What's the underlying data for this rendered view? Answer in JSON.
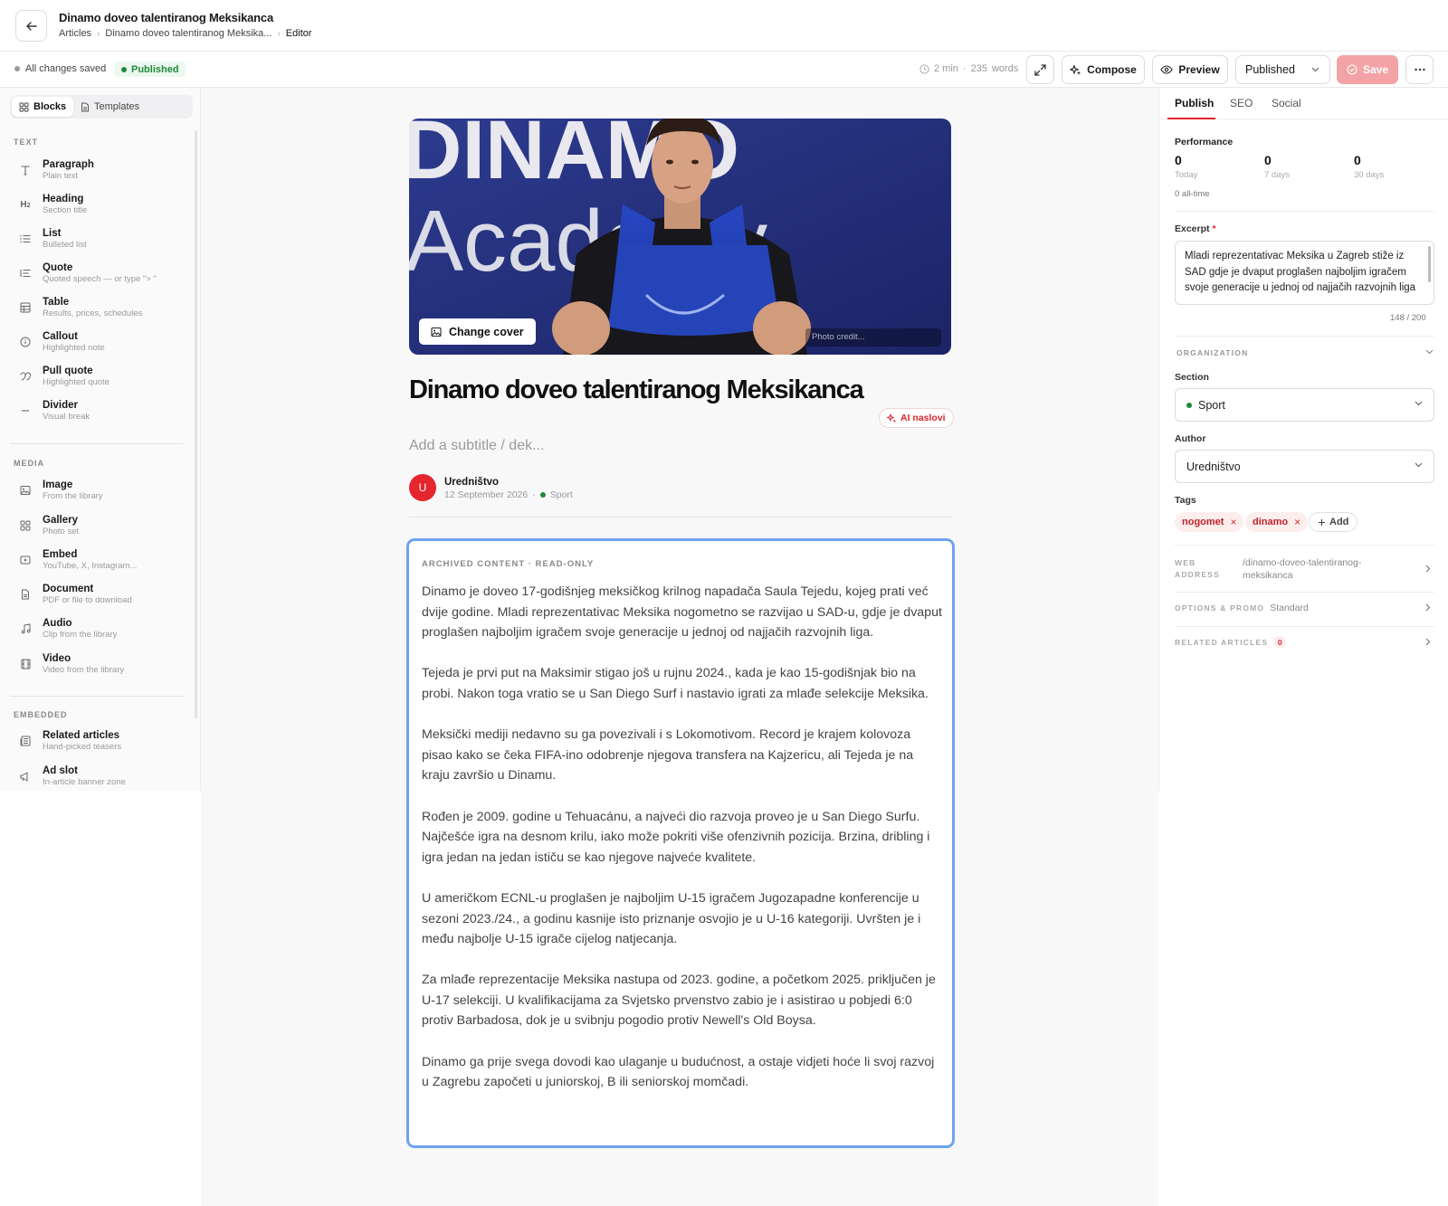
{
  "header": {
    "title": "Dinamo doveo talentiranog Meksikanca",
    "breadcrumbs": [
      "Articles",
      "Dinamo doveo talentiranog Meksika...",
      "Editor"
    ]
  },
  "toolbar": {
    "save_status": "All changes saved",
    "status_badge": "Published",
    "read_time": "2 min",
    "separator": "·",
    "word_count": "235",
    "words_label": "words",
    "compose_label": "Compose",
    "preview_label": "Preview",
    "status_select": "Published",
    "save_label": "Save"
  },
  "left_sidebar": {
    "tabs": [
      "Blocks",
      "Templates"
    ],
    "sections": [
      {
        "title": "TEXT",
        "items": [
          {
            "name": "Paragraph",
            "desc": "Plain text",
            "icon": "type-icon"
          },
          {
            "name": "Heading",
            "desc": "Section title",
            "icon": "heading-icon"
          },
          {
            "name": "List",
            "desc": "Bulleted list",
            "icon": "list-icon"
          },
          {
            "name": "Quote",
            "desc": "Quoted speech — or type \"> \"",
            "icon": "quote-icon"
          },
          {
            "name": "Table",
            "desc": "Results, prices, schedules",
            "icon": "table-icon"
          },
          {
            "name": "Callout",
            "desc": "Highlighted note",
            "icon": "info-icon"
          },
          {
            "name": "Pull quote",
            "desc": "Highlighted quote",
            "icon": "pull-quote-icon"
          },
          {
            "name": "Divider",
            "desc": "Visual break",
            "icon": "minus-icon"
          }
        ]
      },
      {
        "title": "MEDIA",
        "items": [
          {
            "name": "Image",
            "desc": "From the library",
            "icon": "image-icon"
          },
          {
            "name": "Gallery",
            "desc": "Photo set",
            "icon": "gallery-icon"
          },
          {
            "name": "Embed",
            "desc": "YouTube, X, Instagram...",
            "icon": "embed-icon"
          },
          {
            "name": "Document",
            "desc": "PDF or file to download",
            "icon": "document-icon"
          },
          {
            "name": "Audio",
            "desc": "Clip from the library",
            "icon": "music-icon"
          },
          {
            "name": "Video",
            "desc": "Video from the library",
            "icon": "film-icon"
          }
        ]
      },
      {
        "title": "EMBEDDED",
        "items": [
          {
            "name": "Related articles",
            "desc": "Hand-picked teasers",
            "icon": "newspaper-icon"
          },
          {
            "name": "Ad slot",
            "desc": "In-article banner zone",
            "icon": "megaphone-icon"
          }
        ]
      }
    ]
  },
  "editor": {
    "cover_button": "Change cover",
    "photo_credit_placeholder": "Photo credit...",
    "cover_text": [
      "DINAMO",
      "Academy"
    ],
    "title": "Dinamo doveo talentiranog Meksikanca",
    "ai_button": "AI naslovi",
    "subtitle_placeholder": "Add a subtitle / dek...",
    "author_initial": "U",
    "author": "Uredništvo",
    "date": "12 September 2026",
    "meta_sep": "·",
    "section": "Sport",
    "archive_label": "ARCHIVED CONTENT · READ-ONLY",
    "paragraphs": [
      "Dinamo je doveo 17-godišnjeg meksičkog krilnog napadača Saula Tejedu, kojeg prati već dvije godine. Mladi reprezentativac Meksika nogometno se razvijao u SAD-u, gdje je dvaput proglašen najboljim igračem svoje generacije u jednoj od najjačih razvojnih liga.",
      "Tejeda je prvi put na Maksimir stigao još u rujnu 2024., kada je kao 15-godišnjak bio na probi. Nakon toga vratio se u San Diego Surf i nastavio igrati za mlađe selekcije Meksika.",
      "Meksički mediji nedavno su ga povezivali i s Lokomotivom. Record je krajem kolovoza pisao kako se čeka FIFA-ino odobrenje njegova transfera na Kajzericu, ali Tejeda je na kraju završio u Dinamu.",
      "Rođen je 2009. godine u Tehuacánu, a najveći dio razvoja proveo je u San Diego Surfu. Najčešće igra na desnom krilu, iako može pokriti više ofenzivnih pozicija. Brzina, dribling i igra jedan na jedan ističu se kao njegove najveće kvalitete.",
      "U američkom ECNL-u proglašen je najboljim U-15 igračem Jugozapadne konferencije u sezoni 2023./24., a godinu kasnije isto priznanje osvojio je u U-16 kategoriji. Uvršten je i među najbolje U-15 igrače cijelog natjecanja.",
      "Za mlađe reprezentacije Meksika nastupa od 2023. godine, a početkom 2025. priključen je U-17 selekciji. U kvalifikacijama za Svjetsko prvenstvo zabio je i asistirao u pobjedi 6:0 protiv Barbadosa, dok je u svibnju pogodio protiv Newell's Old Boysa.",
      "Dinamo ga prije svega dovodi kao ulaganje u budućnost, a ostaje vidjeti hoće li svoj razvoj u Zagrebu započeti u juniorskoj, B ili seniorskoj momčadi."
    ]
  },
  "right_sidebar": {
    "tabs": [
      "Publish",
      "SEO",
      "Social"
    ],
    "performance": {
      "title": "Performance",
      "stats": [
        {
          "value": "0",
          "label": "Today"
        },
        {
          "value": "0",
          "label": "7 days"
        },
        {
          "value": "0",
          "label": "30 days"
        }
      ],
      "all_time": "0 all-time"
    },
    "excerpt": {
      "label": "Excerpt",
      "required": "*",
      "text": "Mladi reprezentativac Meksika u Zagreb stiže iz SAD gdje je dvaput proglašen najboljim igračem svoje generacije u jednoj od najjačih razvojnih liga",
      "counter": "148 / 200"
    },
    "organization_title": "ORGANIZATION",
    "section": {
      "label": "Section",
      "value": "Sport"
    },
    "author": {
      "label": "Author",
      "value": "Uredništvo"
    },
    "tags": {
      "label": "Tags",
      "items": [
        "nogomet",
        "dinamo"
      ],
      "remove": "×",
      "add_label": "Add"
    },
    "web_address": {
      "label_1": "WEB",
      "label_2": "ADDRESS",
      "value_1": "/dinamo-doveo-talentiranog-",
      "value_2": "meksikanca"
    },
    "options": {
      "label": "OPTIONS & PROMO",
      "value": "Standard"
    },
    "related": {
      "label": "RELATED ARTICLES",
      "count": "0"
    }
  },
  "colors": {
    "accent": "#e5262d",
    "success": "#1f8a3a",
    "focus": "#6fa3ef",
    "save_disabled": "#f3a3a5"
  }
}
